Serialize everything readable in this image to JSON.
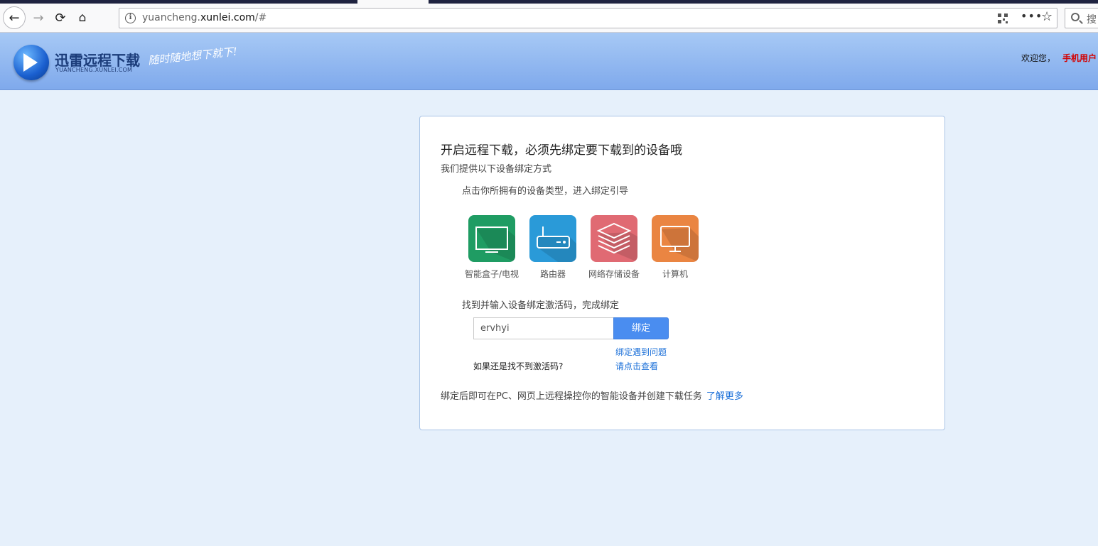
{
  "browser": {
    "url_prefix": "yuancheng.",
    "url_domain": "xunlei.com",
    "url_suffix": "/#",
    "search_placeholder": "搜"
  },
  "header": {
    "logo_title": "迅雷远程下载",
    "logo_sub": "YUANCHENG.XUNLEI.COM",
    "slogan": "随时随地想下就下!",
    "welcome": "欢迎您，",
    "user": "手机用户"
  },
  "card": {
    "title": "开启远程下载，必须先绑定要下载到的设备哦",
    "subtitle": "我们提供以下设备绑定方式",
    "step1": "点击你所拥有的设备类型，进入绑定引导",
    "devices": [
      {
        "label": "智能盒子/电视",
        "color": "#1f9c63",
        "icon": "tv-icon"
      },
      {
        "label": "路由器",
        "color": "#2a9ad8",
        "icon": "router-icon"
      },
      {
        "label": "网络存储设备",
        "color": "#e06a73",
        "icon": "storage-icon"
      },
      {
        "label": "计算机",
        "color": "#ea8542",
        "icon": "computer-icon"
      }
    ],
    "step2": "找到并输入设备绑定激活码，完成绑定",
    "code_value": "ervhyi",
    "bind_label": "绑定",
    "help_link1": "绑定遇到问题",
    "help_question": "如果还是找不到激活码?",
    "help_link2": "请点击查看",
    "footer_note": "绑定后即可在PC、网页上远程操控你的智能设备并创建下载任务",
    "learn_more": "了解更多"
  }
}
